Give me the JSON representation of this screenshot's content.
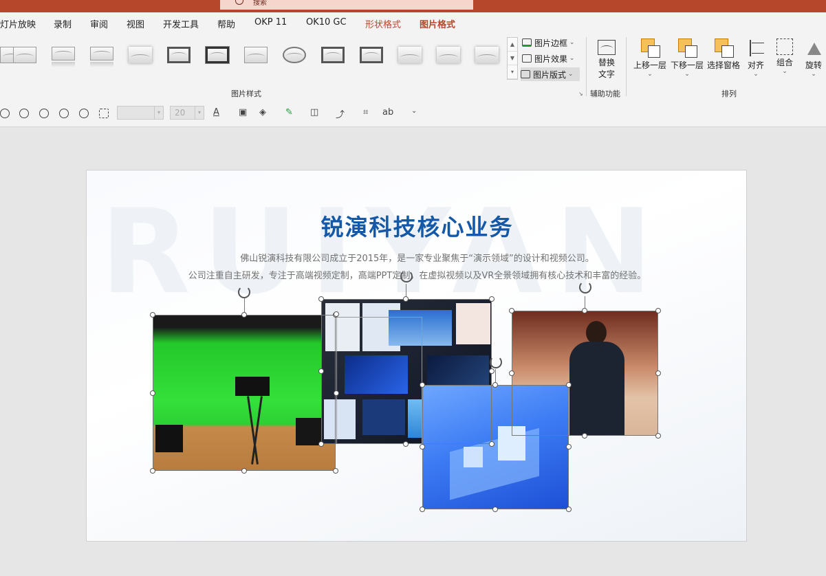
{
  "window": {
    "search_placeholder": "搜索",
    "brand_color": "#b7472a"
  },
  "tabs": [
    {
      "label": "灯片放映",
      "state": "normal"
    },
    {
      "label": "录制",
      "state": "normal"
    },
    {
      "label": "审阅",
      "state": "normal"
    },
    {
      "label": "视图",
      "state": "normal"
    },
    {
      "label": "开发工具",
      "state": "normal"
    },
    {
      "label": "帮助",
      "state": "normal"
    },
    {
      "label": "OKP 11",
      "state": "normal"
    },
    {
      "label": "OK10 GC",
      "state": "normal"
    },
    {
      "label": "形状格式",
      "state": "contextual"
    },
    {
      "label": "图片格式",
      "state": "active"
    }
  ],
  "ribbon": {
    "picture_styles_group_label": "图片样式",
    "picture_border": "图片边框",
    "picture_effects": "图片效果",
    "picture_layout": "图片版式",
    "alt_text_line1": "替换",
    "alt_text_line2": "文字",
    "accessibility_group_label": "辅助功能",
    "bring_forward": "上移一层",
    "send_backward": "下移一层",
    "selection_pane": "选择窗格",
    "align": "对齐",
    "group": "组合",
    "rotate": "旋转",
    "arrange_group_label": "排列",
    "gallery_scroll": [
      "▲",
      "▼",
      "▾"
    ]
  },
  "qat": {
    "font_box_value": "",
    "size_box_value": "20",
    "dropdown_glyph": "▾"
  },
  "slide": {
    "watermark": "RUIYAN",
    "title": "锐演科技核心业务",
    "desc_line1": "佛山锐演科技有限公司成立于2015年，是一家专业聚焦于“演示领域”的设计和视频公司。",
    "desc_line2": "公司注重自主研发，专注于高端视频定制，高端PPT定制，在虚拟视频以及VR全景领域拥有核心技术和丰富的经验。",
    "title_color": "#1458a8"
  },
  "images": [
    {
      "name": "green-screen-studio-image"
    },
    {
      "name": "ppt-design-collage-image"
    },
    {
      "name": "speaker-conference-image"
    },
    {
      "name": "isometric-tech-image"
    }
  ]
}
